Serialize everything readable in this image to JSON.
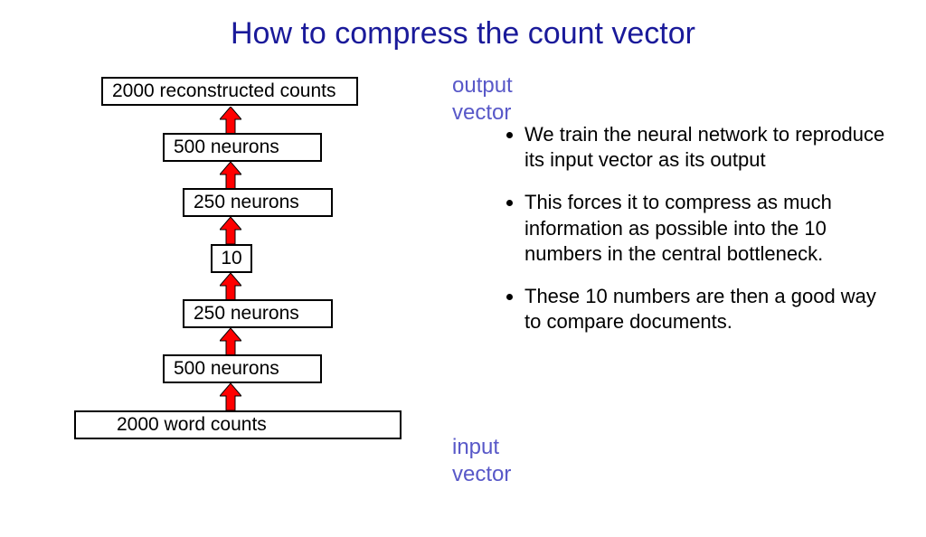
{
  "title": "How to compress the count vector",
  "labels": {
    "output": "output vector",
    "input": "input vector"
  },
  "layers": [
    {
      "text": "2000  reconstructed counts"
    },
    {
      "text": "500 neurons"
    },
    {
      "text": "250 neurons"
    },
    {
      "text": "10"
    },
    {
      "text": "250 neurons"
    },
    {
      "text": "500 neurons"
    },
    {
      "text": "2000  word counts"
    }
  ],
  "bullets": [
    "We train the neural network to reproduce its input vector as its output",
    "This forces it to compress as much information as possible into the 10 numbers in the central bottleneck.",
    "These 10 numbers are then a good way to compare documents."
  ],
  "colors": {
    "title": "#1a1a9a",
    "label": "#5858c8",
    "arrow_fill": "#ff0000",
    "arrow_stroke": "#000000"
  }
}
